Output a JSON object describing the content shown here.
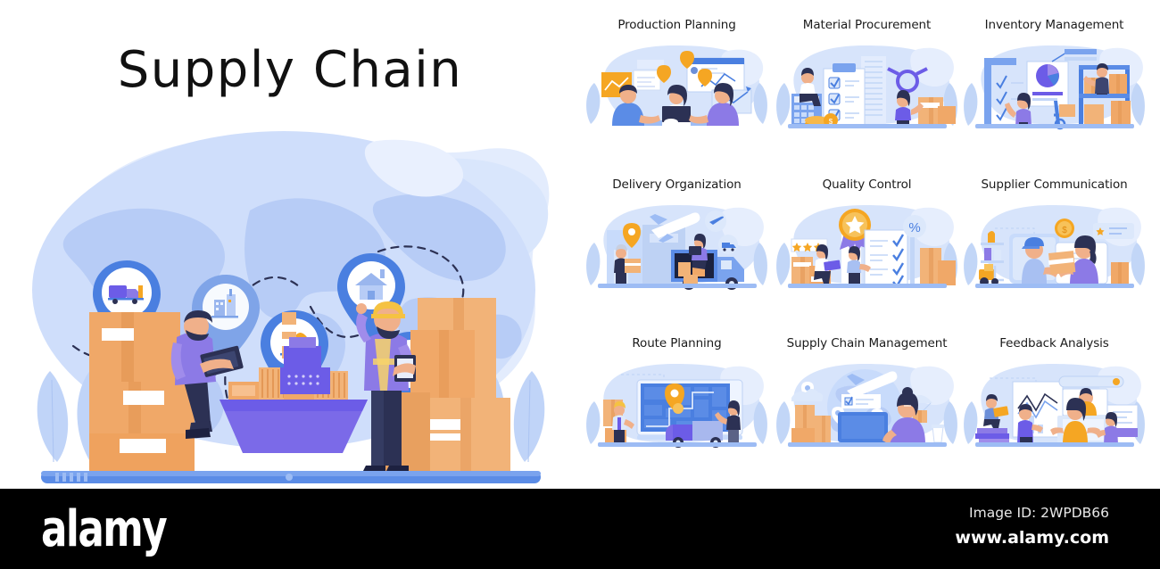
{
  "hero": {
    "title": "Supply Chain",
    "pins": [
      {
        "name": "truck-pin",
        "icon": "delivery-truck-icon"
      },
      {
        "name": "house-pin",
        "icon": "house-icon"
      },
      {
        "name": "store-pin",
        "icon": "storefront-icon"
      },
      {
        "name": "customers-pin",
        "icon": "people-group-icon"
      },
      {
        "name": "factory-pin",
        "icon": "factory-icon"
      }
    ],
    "scene": {
      "analyst": "man-with-laptop-on-boxes",
      "worker": "warehouse-worker-with-clipboard",
      "vessel": "container-cargo-ship",
      "globe": "world-map-globe"
    }
  },
  "cards": [
    {
      "label": "Production Planning",
      "art": "team-meeting-with-charts"
    },
    {
      "label": "Material Procurement",
      "art": "checklist-calculator-coins"
    },
    {
      "label": "Inventory Management",
      "art": "warehouse-racks-pie-report"
    },
    {
      "label": "Delivery Organization",
      "art": "truck-plane-warehouse"
    },
    {
      "label": "Quality Control",
      "art": "award-medal-checklist"
    },
    {
      "label": "Supplier Communication",
      "art": "parcel-handover-screens"
    },
    {
      "label": "Route Planning",
      "art": "map-tablet-with-pin"
    },
    {
      "label": "Supply Chain Management",
      "art": "operator-monitor-globe"
    },
    {
      "label": "Feedback Analysis",
      "art": "review-charts-people"
    }
  ],
  "footer": {
    "brand": "alamy",
    "image_id": "Image ID: 2WPDB66",
    "url": "www.alamy.com"
  },
  "palette": {
    "blob_light": "#dbe6fb",
    "blob_mid": "#c2d6f7",
    "blue": "#4a7fe0",
    "blue_dark": "#3a6bd0",
    "purple": "#6c5ce7",
    "purple_light": "#8c7ae6",
    "orange": "#f5a623",
    "box": "#f0a868",
    "box_dark": "#e0924e",
    "box_light": "#f7c08f",
    "skin": "#f0b08a",
    "navy": "#2c3154",
    "white": "#ffffff",
    "text": "#1b1b1b",
    "footer_bg": "#000000"
  }
}
